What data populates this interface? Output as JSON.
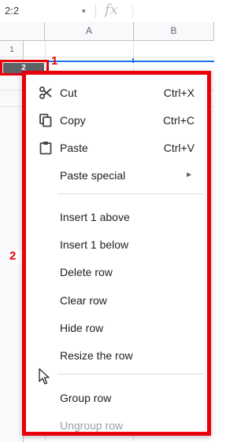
{
  "formula_bar": {
    "name_box": "2:2",
    "name_box_arrow": "▾",
    "fx": "fx"
  },
  "grid": {
    "columns": [
      "A",
      "B"
    ],
    "rows": [
      "1",
      "2"
    ]
  },
  "callouts": {
    "one": "1",
    "two": "2"
  },
  "context_menu": {
    "items": [
      {
        "label": "Cut",
        "shortcut": "Ctrl+X",
        "icon": "scissors-icon"
      },
      {
        "label": "Copy",
        "shortcut": "Ctrl+C",
        "icon": "copy-icon"
      },
      {
        "label": "Paste",
        "shortcut": "Ctrl+V",
        "icon": "clipboard-icon"
      },
      {
        "label": "Paste special",
        "submenu_arrow": "►"
      },
      {
        "label": "Insert 1 above"
      },
      {
        "label": "Insert 1 below"
      },
      {
        "label": "Delete row"
      },
      {
        "label": "Clear row"
      },
      {
        "label": "Hide row"
      },
      {
        "label": "Resize the row"
      },
      {
        "label": "Group row"
      },
      {
        "label": "Ungroup row",
        "disabled": true
      }
    ]
  },
  "colors": {
    "highlight_red": "#e8000a",
    "selection_blue": "#1a73e8",
    "header_bg": "#f8f9fa"
  }
}
